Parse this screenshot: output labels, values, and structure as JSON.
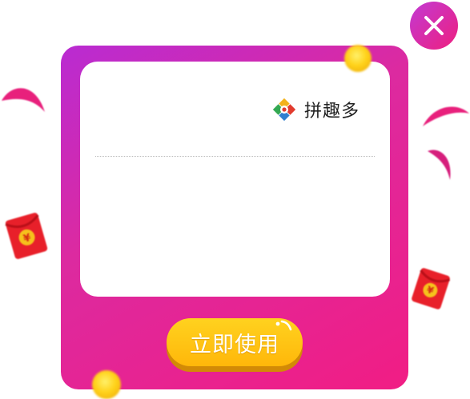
{
  "popup": {
    "brand_name": "拼趣多",
    "brand_icon": "pinquduo-logo-icon",
    "action_label": "立即使用",
    "close_icon": "close-icon"
  },
  "decorations": {
    "red_envelope_symbol": "¥",
    "icons": [
      "coin-icon",
      "red-envelope-icon",
      "confetti-icon"
    ]
  },
  "colors": {
    "card_gradient_start": "#b92bd2",
    "card_gradient_end": "#f11d84",
    "button_yellow": "#ffc414",
    "close_gradient_start": "#c23ad4",
    "close_gradient_end": "#ee1f7e",
    "envelope_red": "#e8202a"
  }
}
